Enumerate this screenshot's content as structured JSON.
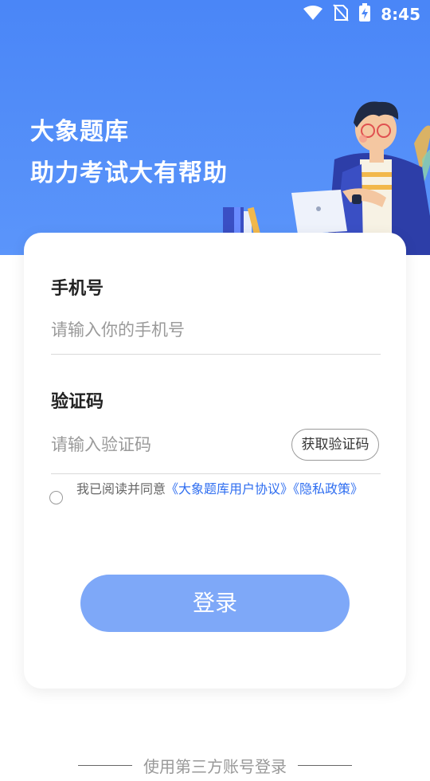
{
  "status_bar": {
    "time": "8:45",
    "icons": [
      "wifi-icon",
      "no-sim-icon",
      "battery-charging-icon"
    ]
  },
  "hero": {
    "title_line1": "大象题库",
    "title_line2": "助力考试大有帮助"
  },
  "form": {
    "phone": {
      "label": "手机号",
      "placeholder": "请输入你的手机号",
      "value": ""
    },
    "code": {
      "label": "验证码",
      "placeholder": "请输入验证码",
      "value": "",
      "button_label": "获取验证码"
    },
    "agreement": {
      "prefix": "我已阅读并同意",
      "user_agreement": "《大象题库用户协议》",
      "privacy": "《隐私政策》",
      "checked": false
    },
    "login_label": "登录"
  },
  "footer": {
    "third_party_label": "使用第三方账号登录"
  },
  "colors": {
    "primary": "#4a86f7",
    "button": "#7ea8f8",
    "link": "#2f6ef0"
  }
}
